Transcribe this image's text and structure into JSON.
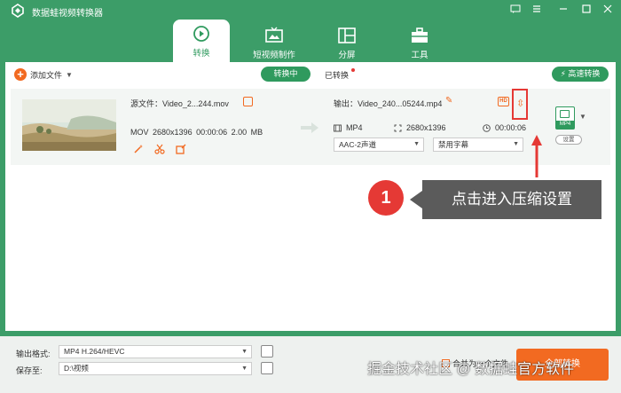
{
  "app": {
    "title": "数据蛙视频转换器"
  },
  "colors": {
    "brand_green": "#3c9d68",
    "accent_orange": "#f26a21",
    "highlight_red": "#e53935"
  },
  "tabs": [
    {
      "label": "转换",
      "icon": "refresh-play-icon",
      "active": true
    },
    {
      "label": "短视频制作",
      "icon": "tv-icon",
      "active": false
    },
    {
      "label": "分屏",
      "icon": "split-screen-icon",
      "active": false
    },
    {
      "label": "工具",
      "icon": "toolbox-icon",
      "active": false
    }
  ],
  "toolbar": {
    "add_file": "添加文件",
    "converting": "转换中",
    "converted": "已转换",
    "speed": "高速转换"
  },
  "file": {
    "source_name": "源文件：Video_2...244.mov",
    "source_format": "MOV",
    "source_resolution": "2680x1396",
    "source_duration": "00:00:06",
    "source_size": "2.00 MB",
    "output_name": "输出：Video_240...05244.mp4",
    "output_format": "MP4",
    "output_resolution": "2680x1396",
    "output_duration": "00:00:06",
    "audio_track": "AAC-2声道",
    "subtitle": "禁用字幕",
    "format_badge": "MP4",
    "settings_label": "设置"
  },
  "annotation": {
    "step_number": "1",
    "text": "点击进入压缩设置"
  },
  "footer": {
    "output_format_label": "输出格式:",
    "output_format_value": "MP4 H.264/HEVC",
    "save_to_label": "保存至:",
    "save_to_value": "D:\\视频",
    "merge_label": "合并为一个文件",
    "convert_all": "全部转换"
  },
  "watermark": "掘金技术社区 @ 数据蛙官方软件"
}
